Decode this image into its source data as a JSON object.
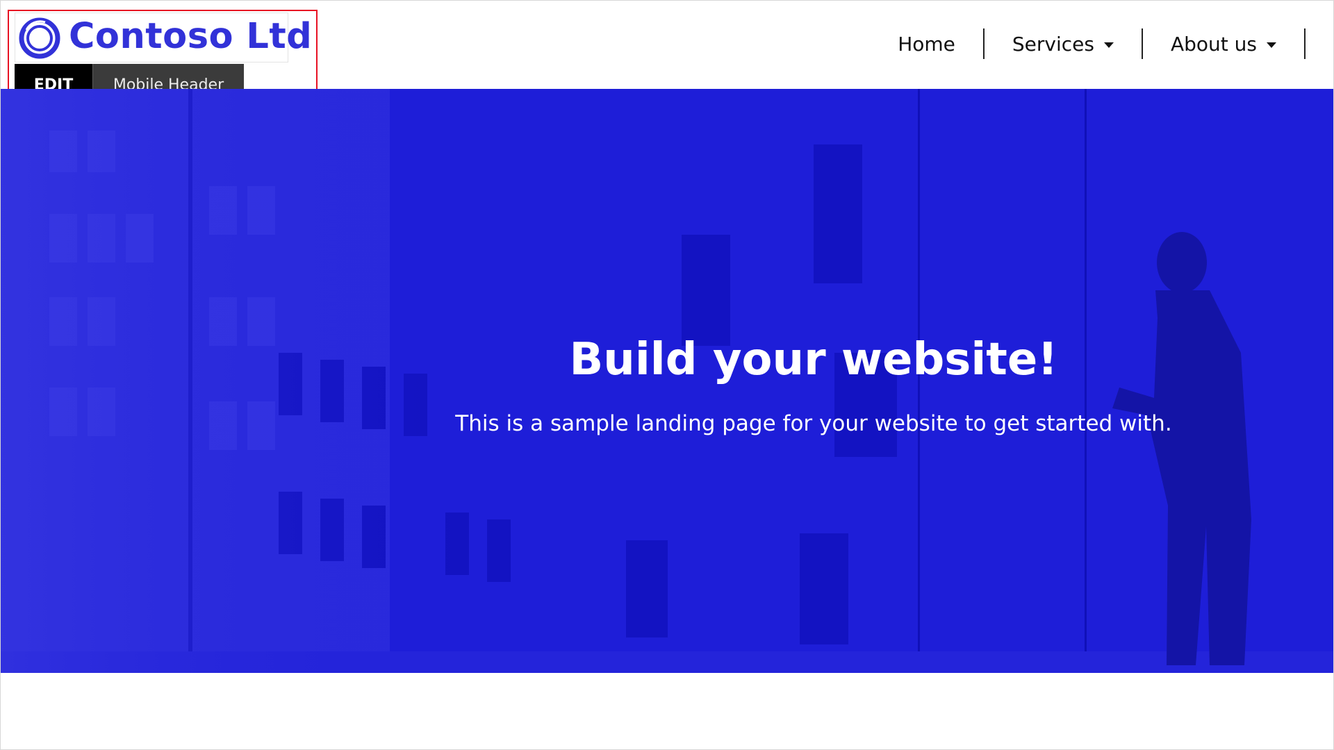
{
  "header": {
    "logo": {
      "text": "Contoso Ltd",
      "icon": "ring-logo-icon",
      "color": "#3232d8"
    },
    "edit_toolbar": {
      "edit_label": "EDIT",
      "component_label": "Mobile Header"
    },
    "selection_color": "#e81123",
    "nav": {
      "items": [
        {
          "label": "Home",
          "has_dropdown": false
        },
        {
          "label": "Services",
          "has_dropdown": true
        },
        {
          "label": "About us",
          "has_dropdown": true
        }
      ]
    }
  },
  "hero": {
    "title": "Build your website!",
    "subtitle": "This is a sample landing page for your website to get started with.",
    "overlay_color": "#1e1ed8"
  }
}
